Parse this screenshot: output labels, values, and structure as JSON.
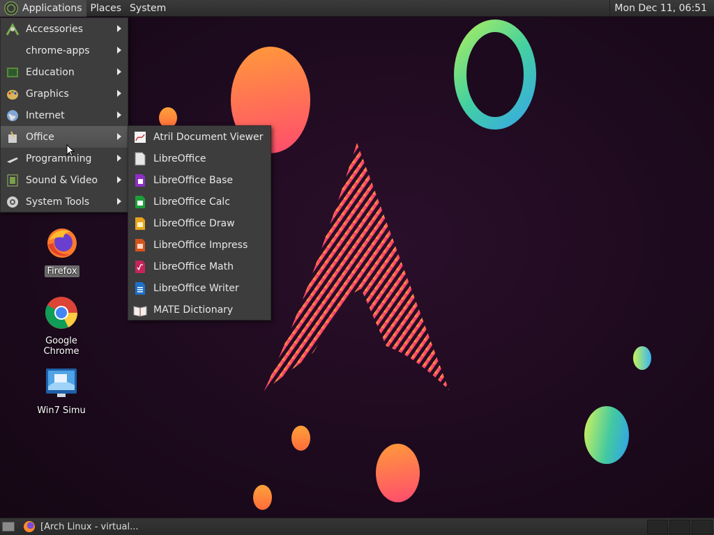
{
  "top_panel": {
    "applications": "Applications",
    "places": "Places",
    "system": "System",
    "clock": "Mon Dec 11, 06:51"
  },
  "apps_menu": {
    "items": [
      {
        "label": "Accessories",
        "icon": "accessories-icon"
      },
      {
        "label": "chrome-apps",
        "icon": "none"
      },
      {
        "label": "Education",
        "icon": "education-icon"
      },
      {
        "label": "Graphics",
        "icon": "graphics-icon"
      },
      {
        "label": "Internet",
        "icon": "internet-icon"
      },
      {
        "label": "Office",
        "icon": "office-icon",
        "highlighted": true
      },
      {
        "label": "Programming",
        "icon": "programming-icon"
      },
      {
        "label": "Sound & Video",
        "icon": "sound-video-icon"
      },
      {
        "label": "System Tools",
        "icon": "system-tools-icon"
      }
    ]
  },
  "office_menu": {
    "items": [
      {
        "label": "Atril Document Viewer",
        "icon": "atril-icon",
        "color": "#e8e8e8"
      },
      {
        "label": "LibreOffice",
        "icon": "libreoffice-icon",
        "color": "#d8d8d8"
      },
      {
        "label": "LibreOffice Base",
        "icon": "libreoffice-base-icon",
        "color": "#8e2fc4"
      },
      {
        "label": "LibreOffice Calc",
        "icon": "libreoffice-calc-icon",
        "color": "#1e9e3a"
      },
      {
        "label": "LibreOffice Draw",
        "icon": "libreoffice-draw-icon",
        "color": "#e8a41c"
      },
      {
        "label": "LibreOffice Impress",
        "icon": "libreoffice-impress-icon",
        "color": "#d4541e"
      },
      {
        "label": "LibreOffice Math",
        "icon": "libreoffice-math-icon",
        "color": "#c4245a"
      },
      {
        "label": "LibreOffice Writer",
        "icon": "libreoffice-writer-icon",
        "color": "#1d71c8"
      },
      {
        "label": "MATE Dictionary",
        "icon": "dictionary-icon",
        "color": "#e8e8e8"
      }
    ]
  },
  "desktop": {
    "icons": [
      {
        "label": "Firefox",
        "icon": "firefox-icon"
      },
      {
        "label": "Google Chrome",
        "icon": "chrome-icon"
      },
      {
        "label": "Win7 Simu",
        "icon": "win7-icon"
      }
    ]
  },
  "taskbar": {
    "window_title": "[Arch Linux - virtual..."
  },
  "colors": {
    "panel": "#2c2c2c",
    "menu_bg": "#3d3d3d",
    "highlight": "#565656",
    "desktop_bg": "#1d0a1e"
  }
}
